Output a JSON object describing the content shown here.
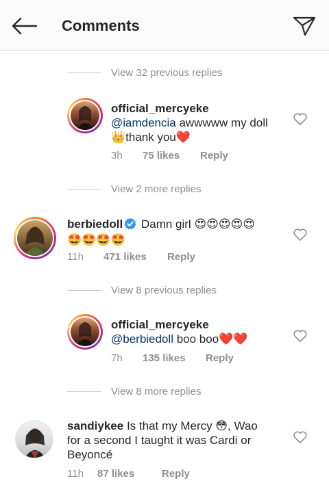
{
  "header": {
    "title": "Comments",
    "back_icon": "arrow-left-icon",
    "send_icon": "paper-plane-icon"
  },
  "dividers": [
    {
      "label": "View 32 previous replies"
    },
    {
      "label": "View 2 more replies"
    },
    {
      "label": "View 8 previous replies"
    },
    {
      "label": "View 8 more replies"
    }
  ],
  "comments": [
    {
      "username": "official_mercyeke",
      "mention": "@iamdencia",
      "text_line1": " awwwww my doll",
      "text_line2_emoji": "👑",
      "text_line2": "thank you",
      "text_line2_end": "❤️",
      "time": "3h",
      "likes": "75 likes",
      "reply": "Reply"
    },
    {
      "username": "berbiedoll",
      "text_start": "Damn girl ",
      "emoji_line1": "😍😍😍😍😍",
      "emoji_line2": "🤩🤩🤩🤩",
      "time": "11h",
      "likes": "471 likes",
      "reply": "Reply"
    },
    {
      "username": "official_mercyeke",
      "mention": "@berbiedoll",
      "text": " boo boo",
      "text_end": "❤️❤️",
      "time": "7h",
      "likes": "135 likes",
      "reply": "Reply"
    },
    {
      "username": "sandiykee",
      "text_line1": " Is that my Mercy ",
      "emoji": "😳",
      "text_line1b": ", Wao",
      "text_line2": "for a second I taught it was Cardi or",
      "text_line3": "Beyoncé",
      "time": "11h",
      "likes": "87 likes",
      "reply": "Reply"
    }
  ],
  "colors": {
    "header_bg": "#fafafa",
    "text": "#262626",
    "muted": "#8e8e8e",
    "mention": "#003569",
    "verified": "#3897f0"
  }
}
